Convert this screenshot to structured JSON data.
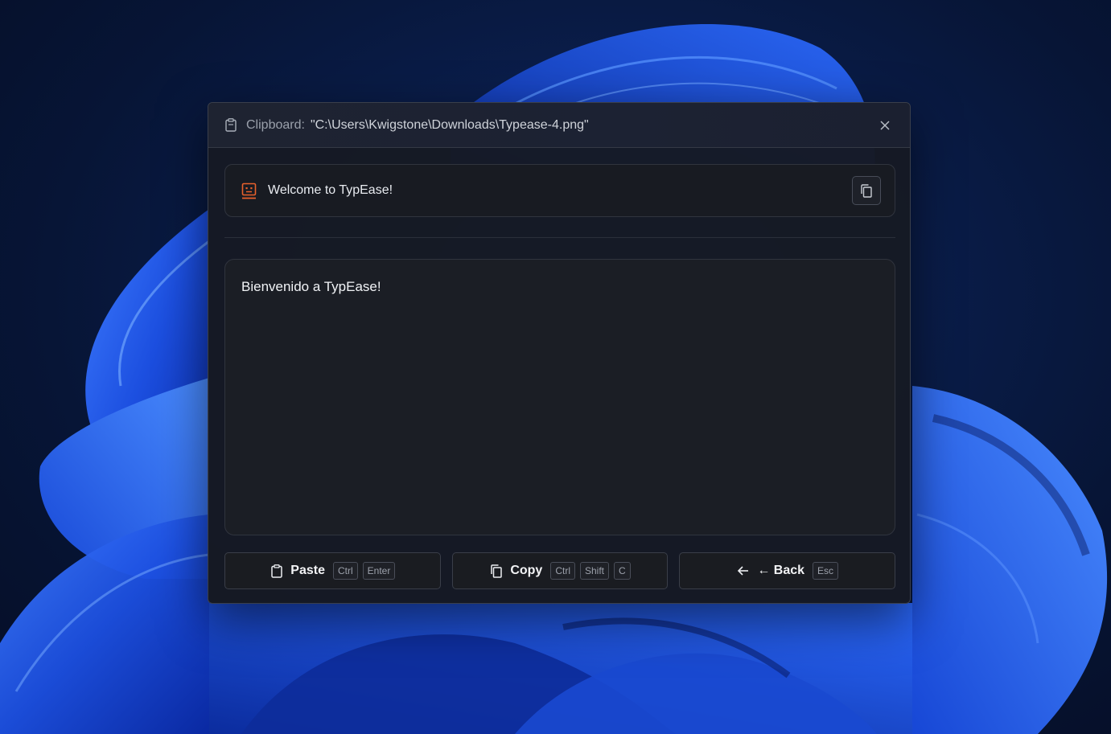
{
  "window": {
    "title_label": "Clipboard:",
    "title_path": "\"C:\\Users\\Kwigstone\\Downloads\\Typease-4.png\""
  },
  "source": {
    "text": "Welcome to TypEase!"
  },
  "result": {
    "text": "Bienvenido a TypEase!"
  },
  "actions": {
    "paste": {
      "label": "Paste",
      "keys": [
        "Ctrl",
        "Enter"
      ]
    },
    "copy": {
      "label": "Copy",
      "keys": [
        "Ctrl",
        "Shift",
        "C"
      ]
    },
    "back": {
      "label": "← Back",
      "keys": [
        "Esc"
      ]
    }
  },
  "colors": {
    "accent_robot": "#e8612c",
    "window_bg": "#161a24",
    "text_primary": "#f1f3f6"
  },
  "icons": {
    "title": "clipboard-icon",
    "close": "close-icon",
    "source": "robot-icon",
    "copy_small": "copy-icon",
    "paste": "clipboard-icon",
    "copy": "copy-icon",
    "back": "arrow-left-icon"
  }
}
